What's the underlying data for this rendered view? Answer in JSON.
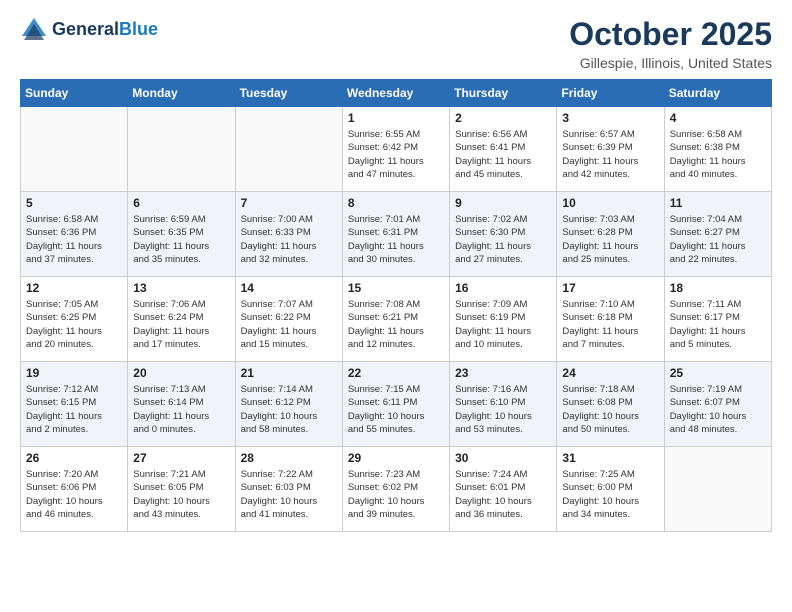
{
  "header": {
    "logo_line1": "General",
    "logo_line2": "Blue",
    "month_title": "October 2025",
    "location": "Gillespie, Illinois, United States"
  },
  "days_of_week": [
    "Sunday",
    "Monday",
    "Tuesday",
    "Wednesday",
    "Thursday",
    "Friday",
    "Saturday"
  ],
  "weeks": [
    {
      "shaded": false,
      "days": [
        {
          "num": "",
          "info": ""
        },
        {
          "num": "",
          "info": ""
        },
        {
          "num": "",
          "info": ""
        },
        {
          "num": "1",
          "info": "Sunrise: 6:55 AM\nSunset: 6:42 PM\nDaylight: 11 hours\nand 47 minutes."
        },
        {
          "num": "2",
          "info": "Sunrise: 6:56 AM\nSunset: 6:41 PM\nDaylight: 11 hours\nand 45 minutes."
        },
        {
          "num": "3",
          "info": "Sunrise: 6:57 AM\nSunset: 6:39 PM\nDaylight: 11 hours\nand 42 minutes."
        },
        {
          "num": "4",
          "info": "Sunrise: 6:58 AM\nSunset: 6:38 PM\nDaylight: 11 hours\nand 40 minutes."
        }
      ]
    },
    {
      "shaded": true,
      "days": [
        {
          "num": "5",
          "info": "Sunrise: 6:58 AM\nSunset: 6:36 PM\nDaylight: 11 hours\nand 37 minutes."
        },
        {
          "num": "6",
          "info": "Sunrise: 6:59 AM\nSunset: 6:35 PM\nDaylight: 11 hours\nand 35 minutes."
        },
        {
          "num": "7",
          "info": "Sunrise: 7:00 AM\nSunset: 6:33 PM\nDaylight: 11 hours\nand 32 minutes."
        },
        {
          "num": "8",
          "info": "Sunrise: 7:01 AM\nSunset: 6:31 PM\nDaylight: 11 hours\nand 30 minutes."
        },
        {
          "num": "9",
          "info": "Sunrise: 7:02 AM\nSunset: 6:30 PM\nDaylight: 11 hours\nand 27 minutes."
        },
        {
          "num": "10",
          "info": "Sunrise: 7:03 AM\nSunset: 6:28 PM\nDaylight: 11 hours\nand 25 minutes."
        },
        {
          "num": "11",
          "info": "Sunrise: 7:04 AM\nSunset: 6:27 PM\nDaylight: 11 hours\nand 22 minutes."
        }
      ]
    },
    {
      "shaded": false,
      "days": [
        {
          "num": "12",
          "info": "Sunrise: 7:05 AM\nSunset: 6:25 PM\nDaylight: 11 hours\nand 20 minutes."
        },
        {
          "num": "13",
          "info": "Sunrise: 7:06 AM\nSunset: 6:24 PM\nDaylight: 11 hours\nand 17 minutes."
        },
        {
          "num": "14",
          "info": "Sunrise: 7:07 AM\nSunset: 6:22 PM\nDaylight: 11 hours\nand 15 minutes."
        },
        {
          "num": "15",
          "info": "Sunrise: 7:08 AM\nSunset: 6:21 PM\nDaylight: 11 hours\nand 12 minutes."
        },
        {
          "num": "16",
          "info": "Sunrise: 7:09 AM\nSunset: 6:19 PM\nDaylight: 11 hours\nand 10 minutes."
        },
        {
          "num": "17",
          "info": "Sunrise: 7:10 AM\nSunset: 6:18 PM\nDaylight: 11 hours\nand 7 minutes."
        },
        {
          "num": "18",
          "info": "Sunrise: 7:11 AM\nSunset: 6:17 PM\nDaylight: 11 hours\nand 5 minutes."
        }
      ]
    },
    {
      "shaded": true,
      "days": [
        {
          "num": "19",
          "info": "Sunrise: 7:12 AM\nSunset: 6:15 PM\nDaylight: 11 hours\nand 2 minutes."
        },
        {
          "num": "20",
          "info": "Sunrise: 7:13 AM\nSunset: 6:14 PM\nDaylight: 11 hours\nand 0 minutes."
        },
        {
          "num": "21",
          "info": "Sunrise: 7:14 AM\nSunset: 6:12 PM\nDaylight: 10 hours\nand 58 minutes."
        },
        {
          "num": "22",
          "info": "Sunrise: 7:15 AM\nSunset: 6:11 PM\nDaylight: 10 hours\nand 55 minutes."
        },
        {
          "num": "23",
          "info": "Sunrise: 7:16 AM\nSunset: 6:10 PM\nDaylight: 10 hours\nand 53 minutes."
        },
        {
          "num": "24",
          "info": "Sunrise: 7:18 AM\nSunset: 6:08 PM\nDaylight: 10 hours\nand 50 minutes."
        },
        {
          "num": "25",
          "info": "Sunrise: 7:19 AM\nSunset: 6:07 PM\nDaylight: 10 hours\nand 48 minutes."
        }
      ]
    },
    {
      "shaded": false,
      "days": [
        {
          "num": "26",
          "info": "Sunrise: 7:20 AM\nSunset: 6:06 PM\nDaylight: 10 hours\nand 46 minutes."
        },
        {
          "num": "27",
          "info": "Sunrise: 7:21 AM\nSunset: 6:05 PM\nDaylight: 10 hours\nand 43 minutes."
        },
        {
          "num": "28",
          "info": "Sunrise: 7:22 AM\nSunset: 6:03 PM\nDaylight: 10 hours\nand 41 minutes."
        },
        {
          "num": "29",
          "info": "Sunrise: 7:23 AM\nSunset: 6:02 PM\nDaylight: 10 hours\nand 39 minutes."
        },
        {
          "num": "30",
          "info": "Sunrise: 7:24 AM\nSunset: 6:01 PM\nDaylight: 10 hours\nand 36 minutes."
        },
        {
          "num": "31",
          "info": "Sunrise: 7:25 AM\nSunset: 6:00 PM\nDaylight: 10 hours\nand 34 minutes."
        },
        {
          "num": "",
          "info": ""
        }
      ]
    }
  ]
}
